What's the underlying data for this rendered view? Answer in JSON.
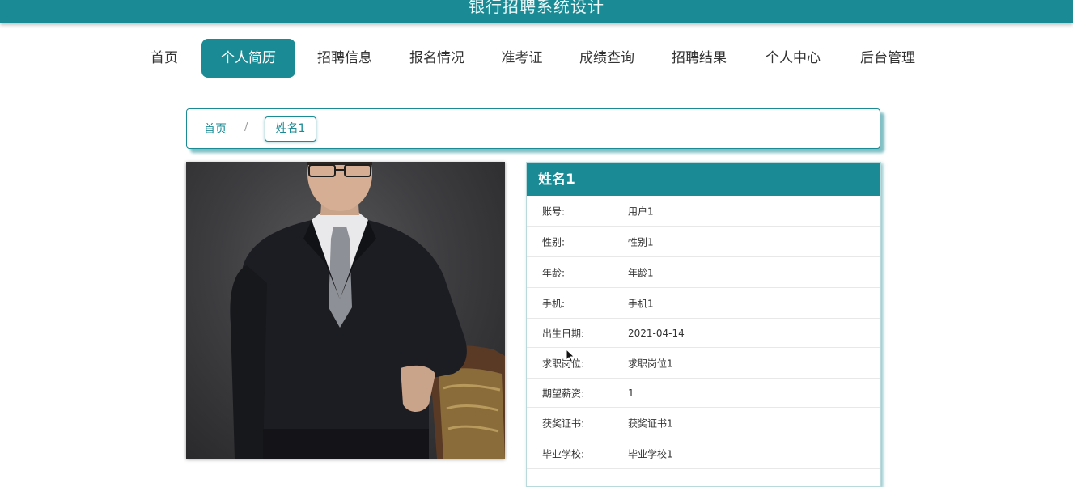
{
  "header": {
    "title": "银行招聘系统设计"
  },
  "nav": {
    "items": [
      {
        "label": "首页"
      },
      {
        "label": "个人简历"
      },
      {
        "label": "招聘信息"
      },
      {
        "label": "报名情况"
      },
      {
        "label": "准考证"
      },
      {
        "label": "成绩查询"
      },
      {
        "label": "招聘结果"
      },
      {
        "label": "个人中心"
      },
      {
        "label": "后台管理"
      }
    ],
    "active_index": 1
  },
  "breadcrumb": {
    "home": "首页",
    "separator": "/",
    "current": "姓名1"
  },
  "profile": {
    "name": "姓名1",
    "fields": [
      {
        "label": "账号:",
        "value": "用户1"
      },
      {
        "label": "性别:",
        "value": "性别1"
      },
      {
        "label": "年龄:",
        "value": "年龄1"
      },
      {
        "label": "手机:",
        "value": "手机1"
      },
      {
        "label": "出生日期:",
        "value": "2021-04-14"
      },
      {
        "label": "求职岗位:",
        "value": "求职岗位1"
      },
      {
        "label": "期望薪资:",
        "value": "1"
      },
      {
        "label": "获奖证书:",
        "value": "获奖证书1"
      },
      {
        "label": "毕业学校:",
        "value": "毕业学校1"
      }
    ]
  },
  "colors": {
    "accent": "#1a8a94",
    "text": "#333333"
  }
}
